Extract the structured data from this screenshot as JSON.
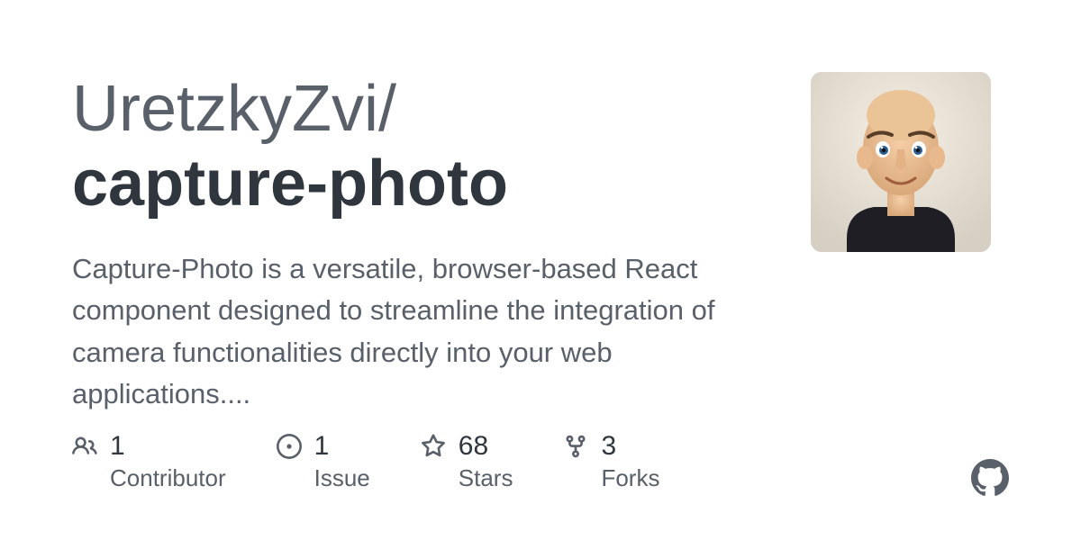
{
  "repo": {
    "owner": "UretzkyZvi",
    "slash": "/",
    "name": "capture-photo"
  },
  "description": "Capture-Photo is a versatile, browser-based React component designed to streamline the integration of camera functionalities directly into your web applications....",
  "stats": {
    "contributors": {
      "count": "1",
      "label": "Contributor"
    },
    "issues": {
      "count": "1",
      "label": "Issue"
    },
    "stars": {
      "count": "68",
      "label": "Stars"
    },
    "forks": {
      "count": "3",
      "label": "Forks"
    }
  }
}
